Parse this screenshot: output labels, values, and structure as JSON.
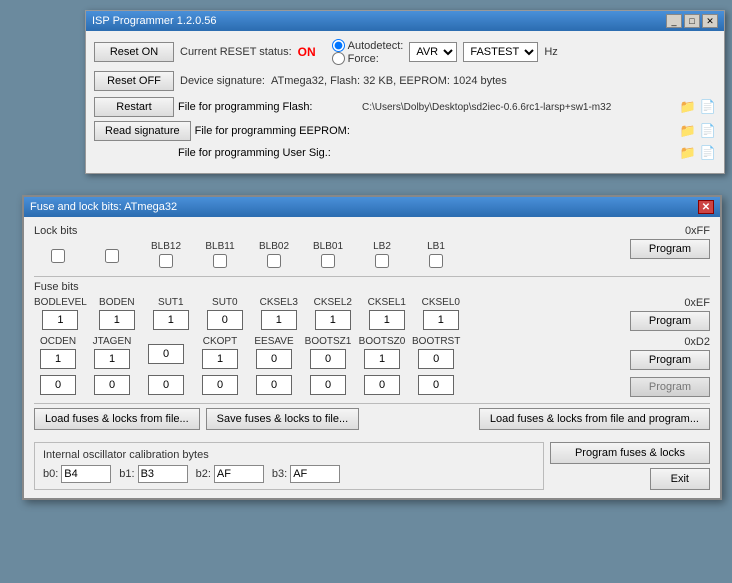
{
  "mainWindow": {
    "title": "ISP Programmer 1.2.0.56",
    "titleButtons": [
      "_",
      "□",
      "✕"
    ],
    "resetOn": "Reset ON",
    "resetOff": "Reset OFF",
    "restart": "Restart",
    "readSignature": "Read signature",
    "currentResetLabel": "Current RESET status:",
    "statusValue": "ON",
    "autodetectLabel": "Autodetect:",
    "forceLabel": "Force:",
    "deviceSignatureLabel": "Device signature:",
    "deviceSignatureValue": "ATmega32, Flash: 32 KB, EEPROM: 1024 bytes",
    "flashLabel": "File for programming Flash:",
    "flashPath": "C:\\Users\\Dolby\\Desktop\\sd2iec-0.6.6rc1-larsp+sw1-m32",
    "eepromLabel": "File for programming EEPROM:",
    "eepromPath": "",
    "userSigLabel": "File for programming User Sig.:",
    "userSigPath": "",
    "speedValue": "FASTEST",
    "deviceValue": "AVR",
    "hzLabel": "Hz"
  },
  "fuseWindow": {
    "title": "Fuse and lock bits: ATmega32",
    "closeBtn": "✕",
    "lockBitsLabel": "Lock bits",
    "lockHex": "0xFF",
    "lockBitNames": [
      "BLB12",
      "BLB11",
      "BLB02",
      "BLB01",
      "LB2",
      "LB1"
    ],
    "lockBitValues": [
      false,
      false,
      false,
      false,
      false,
      false
    ],
    "lockProgramBtn": "Program",
    "fuseBitsLabel": "Fuse bits",
    "fuseHex1": "0xEF",
    "fuseHex2": "0xD2",
    "fuseRow1Names": [
      "BODLEVEL",
      "BODEN",
      "SUT1",
      "SUT0",
      "CKSEL3",
      "CKSEL2",
      "CKSEL1",
      "CKSEL0"
    ],
    "fuseRow1Values": [
      "1",
      "1",
      "1",
      "0",
      "1",
      "1",
      "1",
      "1"
    ],
    "fuseProgramBtn1": "Program",
    "fuseRow2Names": [
      "OCDEN",
      "JTAGEN",
      "",
      "CKOPT",
      "EESAVE",
      "BOOTSZ1",
      "BOOTSZ0",
      "BOOTRST"
    ],
    "fuseRow2Values": [
      "1",
      "1",
      "0",
      "1",
      "0",
      "0",
      "1",
      "0"
    ],
    "fuseProgramBtn2": "Program",
    "emptyRow": [
      "0",
      "0",
      "0",
      "0",
      "0",
      "0",
      "0",
      "0"
    ],
    "emptyProgramBtn": "Program",
    "loadFusesBtn": "Load fuses & locks from file...",
    "saveFusesBtn": "Save fuses & locks to file...",
    "loadProgramBtn": "Load fuses & locks from file and program...",
    "programFusesBtn": "Program fuses & locks",
    "oscTitle": "Internal oscillator calibration bytes",
    "b0Label": "b0:",
    "b0Value": "B4",
    "b1Label": "b1:",
    "b1Value": "B3",
    "b2Label": "b2:",
    "b2Value": "AF",
    "b3Label": "b3:",
    "b3Value": "AF",
    "exitBtn": "Exit"
  }
}
